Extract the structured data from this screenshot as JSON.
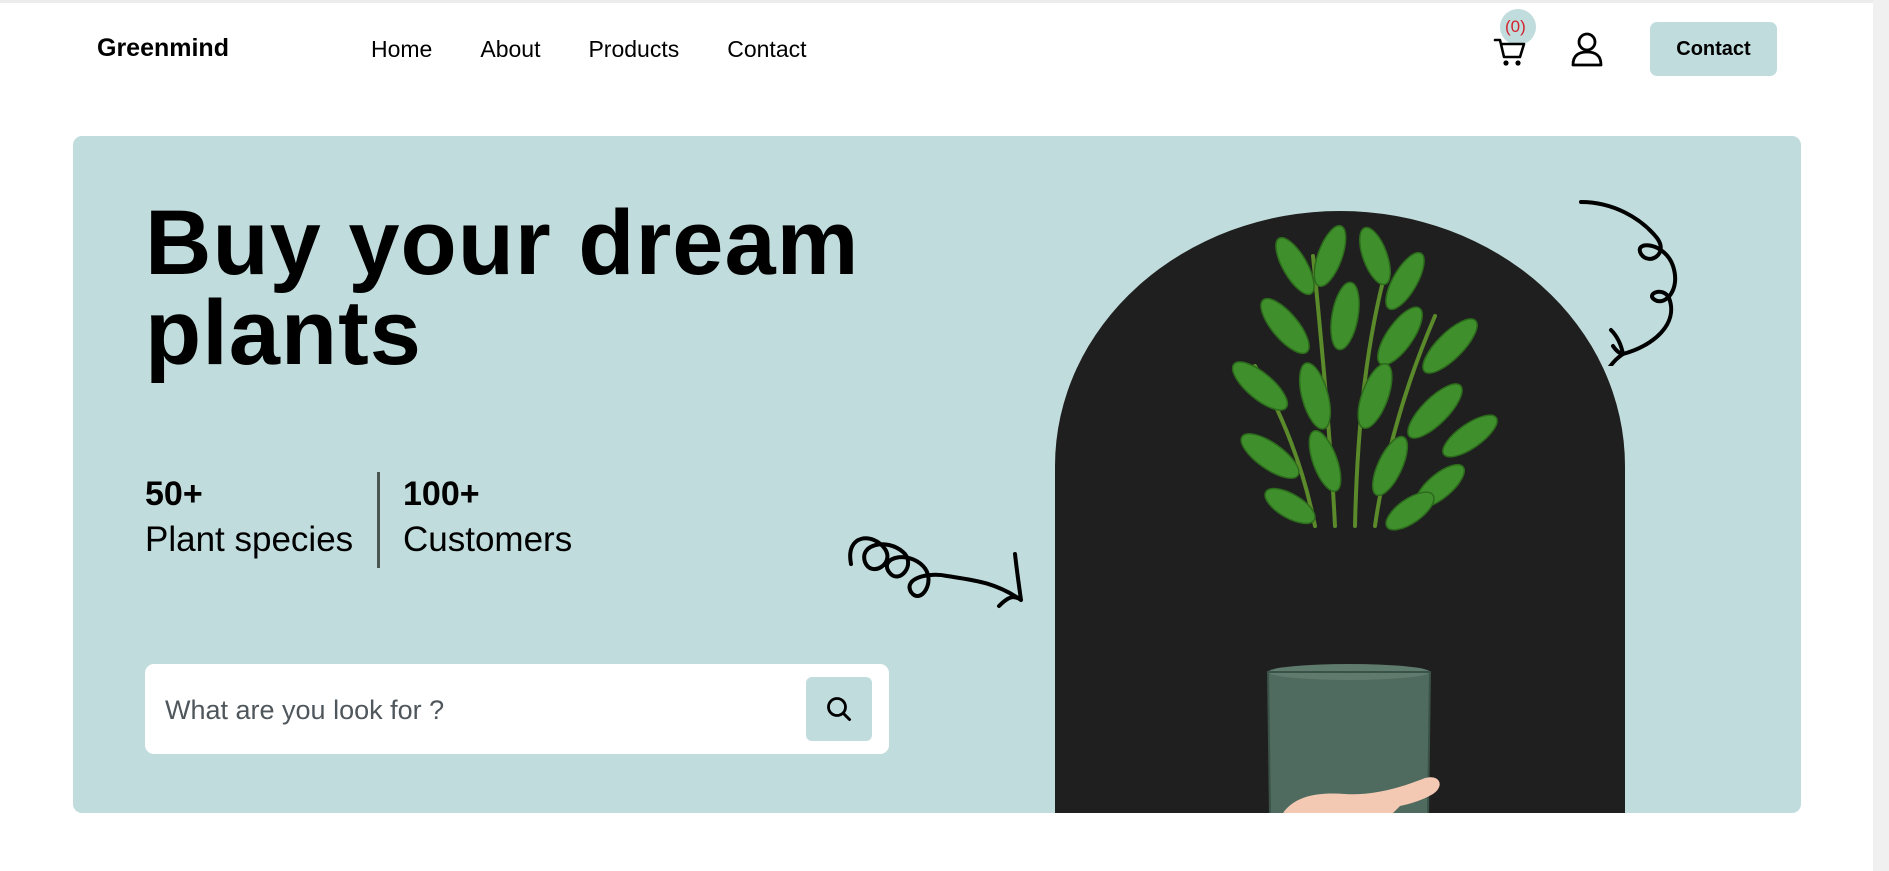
{
  "brand": {
    "name": "Greenmind"
  },
  "nav": {
    "items": [
      "Home",
      "About",
      "Products",
      "Contact"
    ]
  },
  "header": {
    "cart_count": "(0)",
    "contact_label": "Contact",
    "icons": {
      "cart": "shopping-cart-icon",
      "user": "user-icon"
    },
    "badge_count_color": "#d0232d"
  },
  "hero": {
    "title": "Buy your dream plants",
    "stats": [
      {
        "value": "50+",
        "label": "Plant species"
      },
      {
        "value": "100+",
        "label": "Customers"
      }
    ],
    "search": {
      "placeholder": "What are you look for ?"
    },
    "background_color": "#c1dcdc",
    "arch_color": "#1f1f1f"
  }
}
